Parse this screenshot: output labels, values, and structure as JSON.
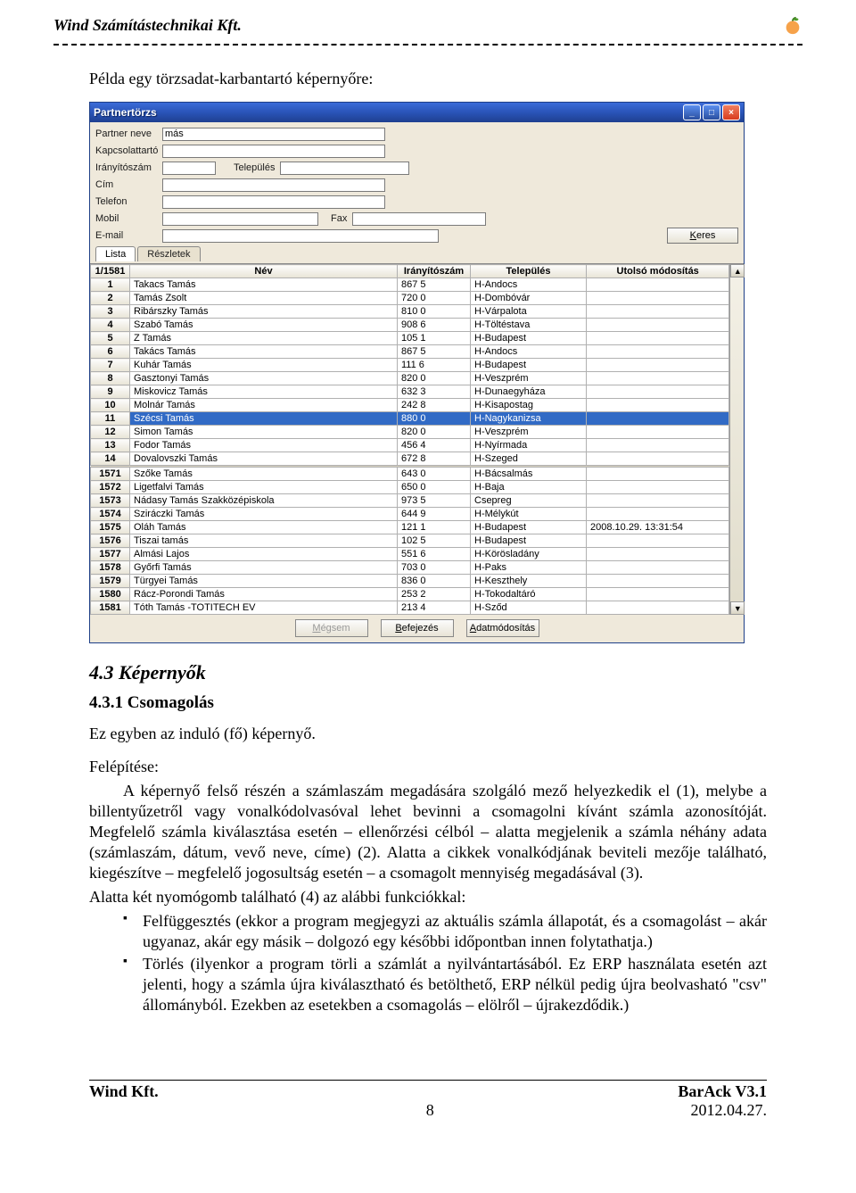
{
  "doc": {
    "company": "Wind Számítástechnikai Kft.",
    "intro": "Példa egy törzsadat-karbantartó képernyőre:"
  },
  "shot": {
    "title": "Partnertörzs",
    "labels": {
      "partnerNeve": "Partner neve",
      "kapcsolattarto": "Kapcsolattartó",
      "iranyitoszam": "Irányítószám",
      "telepules": "Település",
      "cim": "Cím",
      "telefon": "Telefon",
      "mobil": "Mobil",
      "fax": "Fax",
      "email": "E-mail"
    },
    "partnerValue": "más",
    "keres": "Keres",
    "tabs": {
      "lista": "Lista",
      "reszletek": "Részletek"
    },
    "counter": "1/1581",
    "headers": {
      "nev": "Név",
      "zip": "Irányítószám",
      "city": "Település",
      "mod": "Utolsó módosítás"
    },
    "rows1": [
      {
        "n": "1",
        "name": "Takacs Tamás",
        "zip": "867 5",
        "city": "H-Andocs",
        "mod": ""
      },
      {
        "n": "2",
        "name": "Tamás Zsolt",
        "zip": "720 0",
        "city": "H-Dombóvár",
        "mod": ""
      },
      {
        "n": "3",
        "name": "Ribárszky Tamás",
        "zip": "810 0",
        "city": "H-Várpalota",
        "mod": ""
      },
      {
        "n": "4",
        "name": "Szabó Tamás",
        "zip": "908 6",
        "city": "H-Töltéstava",
        "mod": ""
      },
      {
        "n": "5",
        "name": "Z Tamás",
        "zip": "105 1",
        "city": "H-Budapest",
        "mod": ""
      },
      {
        "n": "6",
        "name": "Takács Tamás",
        "zip": "867 5",
        "city": "H-Andocs",
        "mod": ""
      },
      {
        "n": "7",
        "name": "Kuhár Tamás",
        "zip": "111 6",
        "city": "H-Budapest",
        "mod": ""
      },
      {
        "n": "8",
        "name": "Gasztonyi Tamás",
        "zip": "820 0",
        "city": "H-Veszprém",
        "mod": ""
      },
      {
        "n": "9",
        "name": "Miskovicz Tamás",
        "zip": "632 3",
        "city": "H-Dunaegyháza",
        "mod": ""
      },
      {
        "n": "10",
        "name": "Molnár Tamás",
        "zip": "242 8",
        "city": "H-Kisapostag",
        "mod": ""
      },
      {
        "n": "11",
        "name": "Szécsi  Tamás",
        "zip": "880 0",
        "city": "H-Nagykanizsa",
        "mod": "",
        "sel": true
      },
      {
        "n": "12",
        "name": "Simon  Tamás",
        "zip": "820 0",
        "city": "H-Veszprém",
        "mod": ""
      },
      {
        "n": "13",
        "name": "Fodor Tamás",
        "zip": "456 4",
        "city": "H-Nyírmada",
        "mod": ""
      },
      {
        "n": "14",
        "name": "Dovalovszki Tamás",
        "zip": "672 8",
        "city": "H-Szeged",
        "mod": ""
      }
    ],
    "rows2": [
      {
        "n": "1571",
        "name": "Szőke Tamás",
        "zip": "643 0",
        "city": "H-Bácsalmás",
        "mod": ""
      },
      {
        "n": "1572",
        "name": "Ligetfalvi Tamás",
        "zip": "650 0",
        "city": "H-Baja",
        "mod": ""
      },
      {
        "n": "1573",
        "name": "Nádasy Tamás Szakközépiskola",
        "zip": "973 5",
        "city": "Csepreg",
        "mod": ""
      },
      {
        "n": "1574",
        "name": "Sziráczki Tamás",
        "zip": "644 9",
        "city": "H-Mélykút",
        "mod": ""
      },
      {
        "n": "1575",
        "name": "Oláh Tamás",
        "zip": "121 1",
        "city": "H-Budapest",
        "mod": "2008.10.29. 13:31:54"
      },
      {
        "n": "1576",
        "name": "Tiszai tamás",
        "zip": "102 5",
        "city": "H-Budapest",
        "mod": ""
      },
      {
        "n": "1577",
        "name": "Almási Lajos",
        "zip": "551 6",
        "city": "H-Körösladány",
        "mod": ""
      },
      {
        "n": "1578",
        "name": "Győrfi Tamás",
        "zip": "703 0",
        "city": "H-Paks",
        "mod": ""
      },
      {
        "n": "1579",
        "name": "Türgyei Tamás",
        "zip": "836 0",
        "city": "H-Keszthely",
        "mod": ""
      },
      {
        "n": "1580",
        "name": "Rácz-Porondi Tamás",
        "zip": "253 2",
        "city": "H-Tokodaltáró",
        "mod": ""
      },
      {
        "n": "1581",
        "name": "Tóth Tamás -TOTITECH EV",
        "zip": "213 4",
        "city": "H-Sződ",
        "mod": ""
      }
    ],
    "buttons": {
      "megsem": "Mégsem",
      "befejezes": "Befejezés",
      "adatmod": "Adatmódosítás"
    }
  },
  "sections": {
    "h2": "4.3    Képernyők",
    "h3": "4.3.1   Csomagolás",
    "p1": "Ez egyben az induló (fő) képernyő.",
    "p2": "Felépítése:",
    "p3": "A képernyő felső részén a számlaszám megadására szolgáló mező helyezkedik el (1), melybe a billentyűzetről vagy vonalkódolvasóval lehet bevinni a csomagolni kívánt számla azonosítóját. Megfelelő számla kiválasztása esetén – ellenőrzési célból – alatta megjelenik a számla néhány adata (számlaszám, dátum, vevő neve, címe) (2). Alatta a cikkek vonalkódjának beviteli mezője található, kiegészítve – megfelelő jogosultság esetén – a csomagolt mennyiség megadásával (3).",
    "p4": "Alatta két nyomógomb található (4) az alábbi funkciókkal:",
    "li1": "Felfüggesztés (ekkor a program megjegyzi az aktuális számla állapotát, és a csomagolást – akár ugyanaz, akár egy másik – dolgozó egy későbbi időpontban innen folytathatja.)",
    "li2": "Törlés (ilyenkor a program törli a számlát a nyilvántartásából. Ez ERP használata esetén azt jelenti, hogy a számla újra kiválasztható és betölthető, ERP nélkül pedig újra beolvasható \"csv\" állományból. Ezekben az esetekben a csomagolás – elölről – újrakezdődik.)"
  },
  "footer": {
    "left": "Wind Kft.",
    "center1": "",
    "right1": "BarAck   V3.1",
    "center2": "8",
    "right2": "2012.04.27."
  }
}
